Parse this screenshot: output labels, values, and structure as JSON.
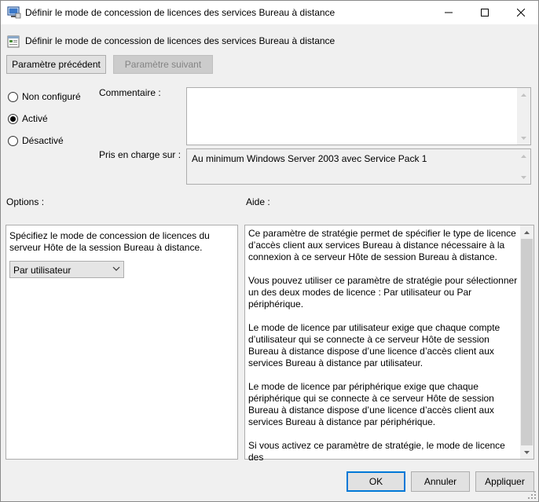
{
  "window": {
    "title": "Définir le mode de concession de licences des services Bureau à distance",
    "controls": {
      "minimize": "minimize-icon",
      "maximize": "maximize-icon",
      "close": "close-icon"
    }
  },
  "header": {
    "policy_name": "Définir le mode de concession de licences des services Bureau à distance",
    "prev_button": "Paramètre précédent",
    "next_button": "Paramètre suivant"
  },
  "state": {
    "options": [
      {
        "label": "Non configuré",
        "checked": false
      },
      {
        "label": "Activé",
        "checked": true
      },
      {
        "label": "Désactivé",
        "checked": false
      }
    ]
  },
  "comment": {
    "label": "Commentaire :",
    "value": ""
  },
  "supported": {
    "label": "Pris en charge sur :",
    "value": "Au minimum Windows Server 2003 avec Service Pack 1"
  },
  "options_panel": {
    "label": "Options :",
    "description": "Spécifiez le mode de concession de licences du serveur Hôte de la session Bureau à distance.",
    "select_value": "Par utilisateur"
  },
  "help_panel": {
    "label": "Aide :",
    "paragraphs": [
      "Ce paramètre de stratégie permet de spécifier le type de licence d’accès client aux services Bureau à distance nécessaire à la connexion à ce serveur Hôte de session Bureau à distance.",
      "Vous pouvez utiliser ce paramètre de stratégie pour sélectionner un des deux modes de licence : Par utilisateur ou Par périphérique.",
      "Le mode de licence par utilisateur exige que chaque compte d’utilisateur qui se connecte à ce serveur Hôte de session Bureau à distance dispose d’une licence d’accès client aux services Bureau à distance par utilisateur.",
      "Le mode de licence par périphérique exige que chaque périphérique qui se connecte à ce serveur Hôte de session Bureau à distance dispose d’une licence d’accès client aux services Bureau à distance par périphérique.",
      "Si vous activez ce paramètre de stratégie, le mode de licence des"
    ]
  },
  "footer": {
    "ok": "OK",
    "cancel": "Annuler",
    "apply": "Appliquer"
  },
  "colors": {
    "accent": "#0078d7",
    "window_bg": "#f0f0f0",
    "scroll_thumb": "#cdcdcd"
  }
}
